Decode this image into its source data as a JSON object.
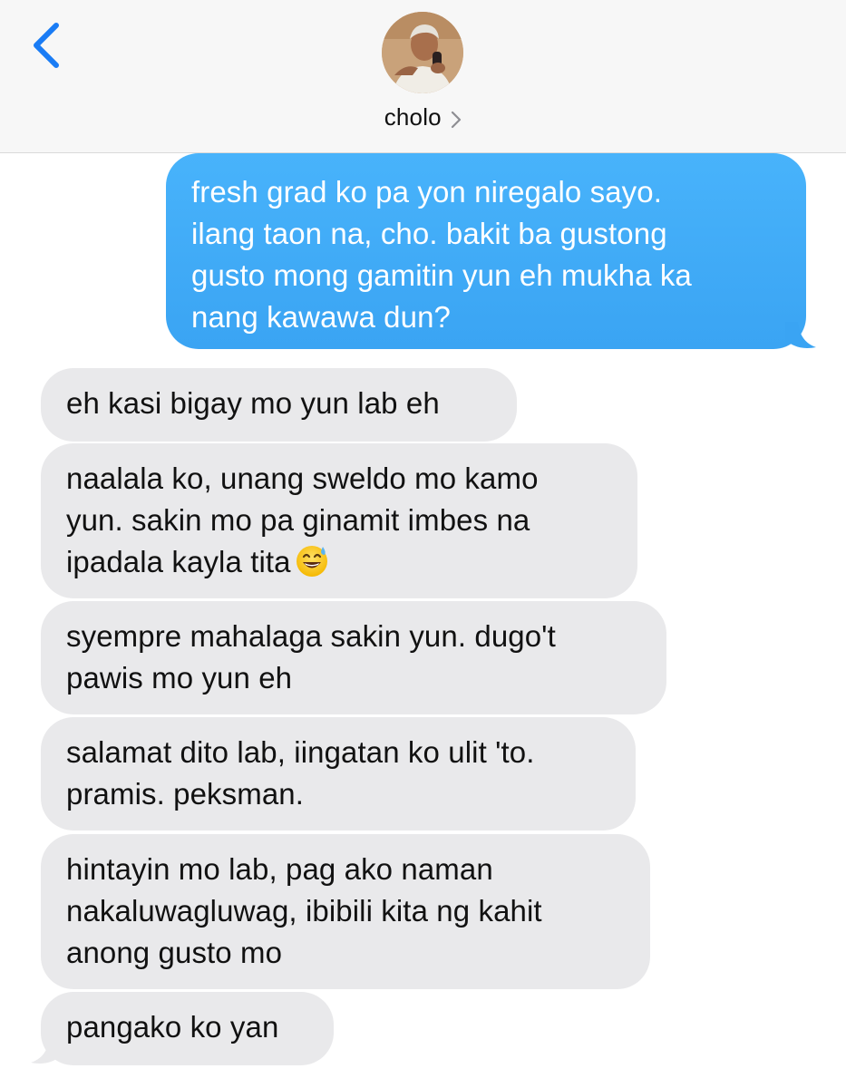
{
  "header": {
    "contact_name": "cholo",
    "back_icon": "chevron-left-icon",
    "avatar_icon": "contact-avatar"
  },
  "colors": {
    "accent": "#1a7cf5",
    "sent_bubble": "#3ea9f5",
    "received_bubble": "#e9e9eb",
    "header_bg": "#f7f7f7"
  },
  "messages": [
    {
      "from": "me",
      "lines": [
        "fresh grad ko pa yon niregalo sayo.",
        "ilang taon na, cho. bakit ba gustong",
        "gusto mong gamitin yun eh mukha ka",
        "nang kawawa dun?"
      ]
    },
    {
      "from": "cholo",
      "lines": [
        "eh kasi bigay mo yun lab eh"
      ]
    },
    {
      "from": "cholo",
      "lines": [
        "naalala ko, unang sweldo mo kamo",
        "yun. sakin mo pa ginamit imbes na",
        "ipadala kayla tita"
      ],
      "emoji": "grinning-sweat-emoji"
    },
    {
      "from": "cholo",
      "lines": [
        "syempre mahalaga sakin yun. dugo't",
        "pawis mo yun eh"
      ]
    },
    {
      "from": "cholo",
      "lines": [
        "salamat dito lab, iingatan ko ulit 'to.",
        "pramis. peksman."
      ]
    },
    {
      "from": "cholo",
      "lines": [
        "hintayin mo lab, pag ako naman",
        "nakaluwagluwag, ibibili kita ng kahit",
        "anong gusto mo"
      ]
    },
    {
      "from": "cholo",
      "lines": [
        "pangako ko yan"
      ]
    }
  ]
}
